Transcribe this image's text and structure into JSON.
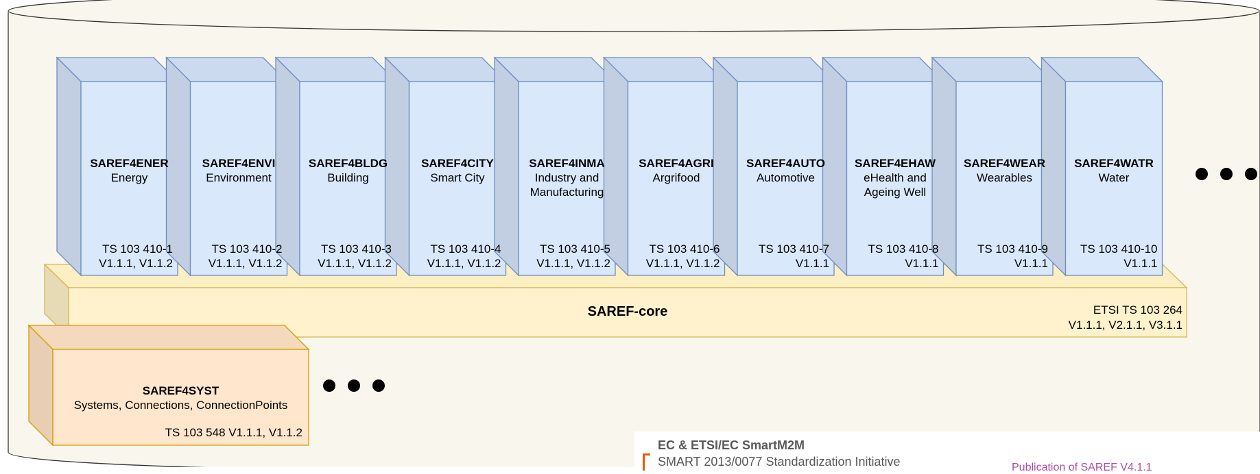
{
  "core": {
    "name": "SAREF-core",
    "spec": "ETSI TS 103 264",
    "versions": "V1.1.1, V2.1.1, V3.1.1"
  },
  "extensions": [
    {
      "name": "SAREF4ENER",
      "domain": [
        "Energy"
      ],
      "spec": "TS 103 410-1",
      "versions": "V1.1.1, V1.1.2"
    },
    {
      "name": "SAREF4ENVI",
      "domain": [
        "Environment"
      ],
      "spec": "TS 103 410-2",
      "versions": "V1.1.1, V1.1.2"
    },
    {
      "name": "SAREF4BLDG",
      "domain": [
        "Building"
      ],
      "spec": "TS 103 410-3",
      "versions": "V1.1.1, V1.1.2"
    },
    {
      "name": "SAREF4CITY",
      "domain": [
        "Smart City"
      ],
      "spec": "TS 103 410-4",
      "versions": "V1.1.1, V1.1.2"
    },
    {
      "name": "SAREF4INMA",
      "domain": [
        "Industry and",
        "Manufacturing"
      ],
      "spec": "TS 103 410-5",
      "versions": "V1.1.1, V1.1.2"
    },
    {
      "name": "SAREF4AGRI",
      "domain": [
        "Argrifood"
      ],
      "spec": "TS 103 410-6",
      "versions": "V1.1.1, V1.1.2"
    },
    {
      "name": "SAREF4AUTO",
      "domain": [
        "Automotive"
      ],
      "spec": "TS 103 410-7",
      "versions": "V1.1.1"
    },
    {
      "name": "SAREF4EHAW",
      "domain": [
        "eHealth and",
        "Ageing Well"
      ],
      "spec": "TS 103 410-8",
      "versions": "V1.1.1"
    },
    {
      "name": "SAREF4WEAR",
      "domain": [
        "Wearables"
      ],
      "spec": "TS 103 410-9",
      "versions": "V1.1.1"
    },
    {
      "name": "SAREF4WATR",
      "domain": [
        "Water"
      ],
      "spec": "TS 103 410-10",
      "versions": "V1.1.1"
    }
  ],
  "system": {
    "name": "SAREF4SYST",
    "domain": "Systems, Connections, ConnectionPoints",
    "spec": "TS 103 548 V1.1.1, V1.1.2"
  },
  "footer": {
    "org": "EC & ETSI/EC SmartM2M",
    "project": "SMART 2013/0077 Standardization Initiative",
    "publication": "Publication of SAREF V4.1.1"
  },
  "colors": {
    "background": "#f9f7ed",
    "extension_fill": "#dae8fc",
    "extension_stroke": "#6c8ebf",
    "core_fill": "#fff2cc",
    "core_stroke": "#d6b656",
    "system_fill": "#ffe6cc",
    "system_stroke": "#d79b00"
  }
}
